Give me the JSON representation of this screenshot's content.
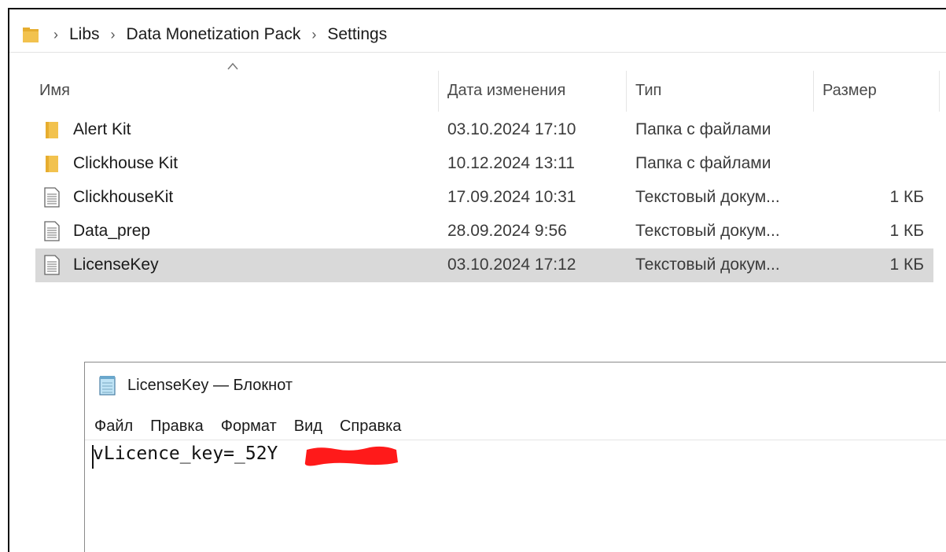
{
  "explorer": {
    "breadcrumb": [
      "Libs",
      "Data Monetization Pack",
      "Settings"
    ],
    "columns": {
      "name": "Имя",
      "date": "Дата изменения",
      "type": "Тип",
      "size": "Размер"
    },
    "rows": [
      {
        "icon": "folder-icon",
        "name": "Alert Kit",
        "date": "03.10.2024 17:10",
        "type": "Папка с файлами",
        "size": ""
      },
      {
        "icon": "folder-icon",
        "name": "Clickhouse Kit",
        "date": "10.12.2024 13:11",
        "type": "Папка с файлами",
        "size": ""
      },
      {
        "icon": "text-file-icon",
        "name": "ClickhouseKit",
        "date": "17.09.2024 10:31",
        "type": "Текстовый докум...",
        "size": "1 КБ"
      },
      {
        "icon": "text-file-icon",
        "name": "Data_prep",
        "date": "28.09.2024 9:56",
        "type": "Текстовый докум...",
        "size": "1 КБ"
      },
      {
        "icon": "text-file-icon",
        "name": "LicenseKey",
        "date": "03.10.2024 17:12",
        "type": "Текстовый докум...",
        "size": "1 КБ",
        "selected": true
      }
    ]
  },
  "notepad": {
    "title": "LicenseKey — Блокнот",
    "menu": [
      "Файл",
      "Правка",
      "Формат",
      "Вид",
      "Справка"
    ],
    "content": "vLicence_key=_52Y"
  },
  "colors": {
    "selection": "#d9d9d9",
    "folder": "#f2c24e",
    "redaction": "#ff1a1a"
  }
}
